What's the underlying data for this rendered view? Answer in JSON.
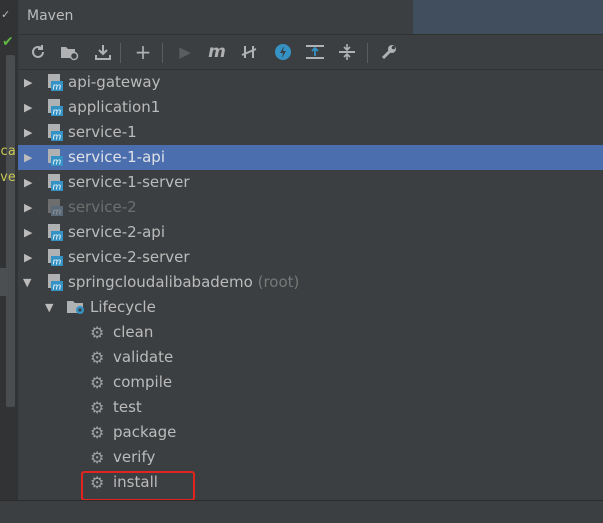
{
  "panel": {
    "title": "Maven"
  },
  "gutter": {
    "text1": "ca",
    "text2": "ve"
  },
  "toolbar": {
    "icons": [
      "reload-icon",
      "generate-sources-icon",
      "download-icon",
      "add-icon",
      "run-icon",
      "execute-goal-icon",
      "toggle-offline-icon",
      "skip-tests-icon",
      "show-dependencies-icon",
      "collapse-all-icon",
      "settings-icon"
    ]
  },
  "tree": {
    "projects": [
      {
        "label": "api-gateway",
        "dim": false
      },
      {
        "label": "application1",
        "dim": false
      },
      {
        "label": "service-1",
        "dim": false
      },
      {
        "label": "service-1-api",
        "dim": false,
        "selected": true
      },
      {
        "label": "service-1-server",
        "dim": false
      },
      {
        "label": "service-2",
        "dim": true
      },
      {
        "label": "service-2-api",
        "dim": false
      },
      {
        "label": "service-2-server",
        "dim": false
      }
    ],
    "root": {
      "label": "springcloudalibabademo",
      "tag": "(root)"
    },
    "lifecycle": {
      "label": "Lifecycle",
      "goals": [
        "clean",
        "validate",
        "compile",
        "test",
        "package",
        "verify",
        "install"
      ]
    }
  },
  "colors": {
    "selection": "#4b6eaf",
    "highlight_box": "#e0251f"
  }
}
